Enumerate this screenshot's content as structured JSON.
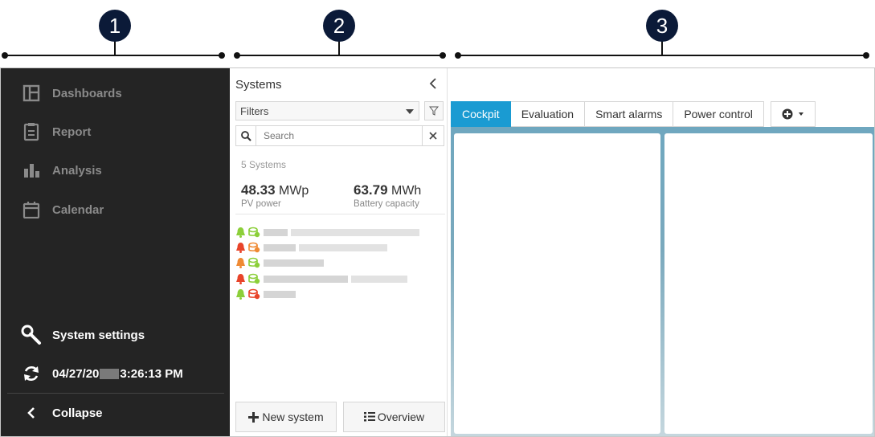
{
  "callouts": [
    "1",
    "2",
    "3"
  ],
  "nav": {
    "items": [
      {
        "label": "Dashboards",
        "icon": "dashboard-icon"
      },
      {
        "label": "Report",
        "icon": "clipboard-icon"
      },
      {
        "label": "Analysis",
        "icon": "bar-chart-icon"
      },
      {
        "label": "Calendar",
        "icon": "calendar-icon"
      }
    ],
    "settings_label": "System settings",
    "date_prefix": "04/27/20",
    "date_suffix": "3:26:13 PM",
    "collapse_label": "Collapse"
  },
  "systems": {
    "title": "Systems",
    "filter_label": "Filters",
    "search_placeholder": "Search",
    "count": "5 Systems",
    "pv_value": "48.33",
    "pv_unit": "MWp",
    "pv_label": "PV power",
    "battery_value": "63.79",
    "battery_unit": "MWh",
    "battery_label": "Battery capacity",
    "rows": [
      {
        "bell": "#8ccf3a",
        "status": "#8ccf3a"
      },
      {
        "bell": "#e8442a",
        "status": "#ef8a34"
      },
      {
        "bell": "#ef8a34",
        "status": "#8ccf3a"
      },
      {
        "bell": "#e8442a",
        "status": "#8ccf3a"
      },
      {
        "bell": "#8ccf3a",
        "status": "#e8442a"
      }
    ],
    "new_system_label": "New system",
    "overview_label": "Overview"
  },
  "tabs": [
    "Cockpit",
    "Evaluation",
    "Smart alarms",
    "Power control"
  ],
  "colors": {
    "accent": "#1a9bd2",
    "nav_bg": "#242424"
  }
}
